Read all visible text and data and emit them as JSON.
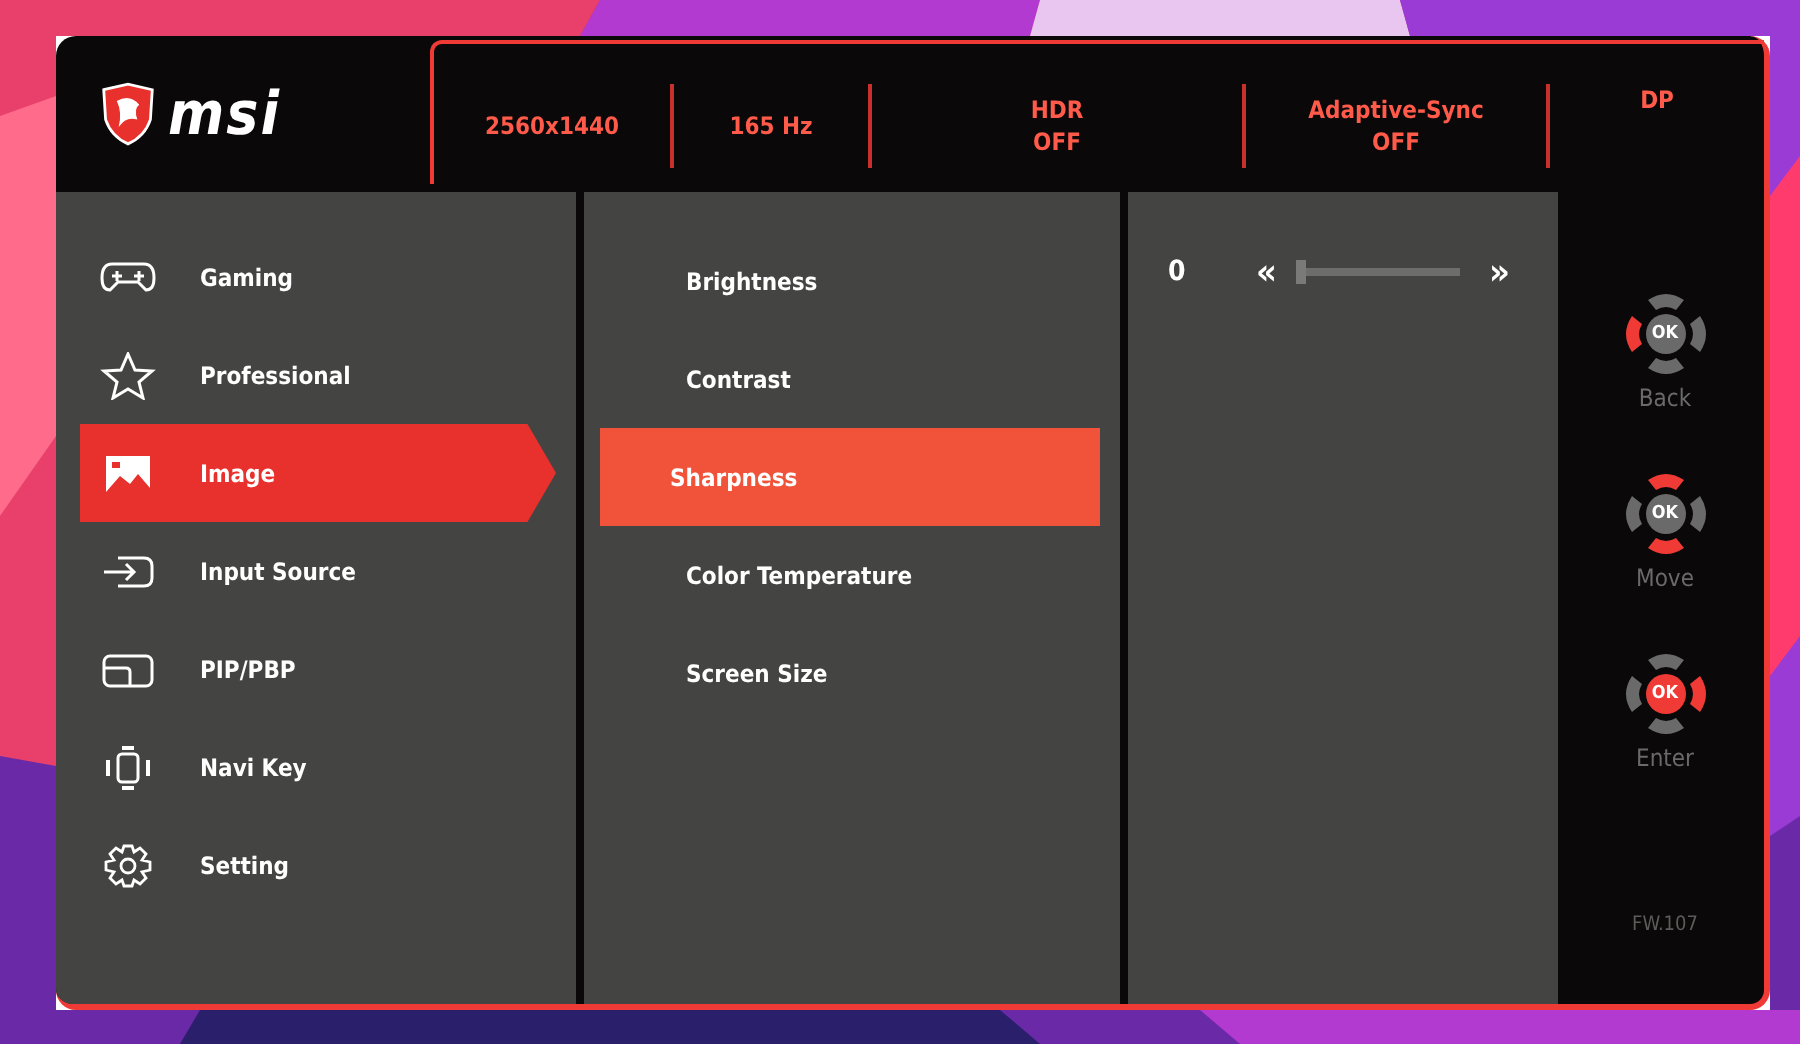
{
  "logo": {
    "text": "msi"
  },
  "status": [
    {
      "lines": [
        "2560x1440"
      ]
    },
    {
      "lines": [
        "165 Hz"
      ]
    },
    {
      "lines": [
        "HDR",
        "OFF"
      ]
    },
    {
      "lines": [
        "Adaptive-Sync",
        "OFF"
      ]
    },
    {
      "lines": [
        "DP"
      ]
    }
  ],
  "menu": [
    {
      "label": "Gaming",
      "kind": "gamepad",
      "selected": false
    },
    {
      "label": "Professional",
      "kind": "star",
      "selected": false
    },
    {
      "label": "Image",
      "selected": true
    },
    {
      "label": "Input Source",
      "kind": "input",
      "selected": false
    },
    {
      "label": "PIP/PBP",
      "kind": "window",
      "selected": false
    },
    {
      "label": "Navi Key",
      "kind": "navi",
      "selected": false
    },
    {
      "label": "Setting",
      "kind": "gear",
      "selected": false
    }
  ],
  "submenu": [
    {
      "label": "Brightness",
      "selected": false
    },
    {
      "label": "Contrast",
      "selected": false
    },
    {
      "label": "Sharpness",
      "selected": true
    },
    {
      "label": "Color Temperature",
      "selected": false
    },
    {
      "label": "Screen Size",
      "selected": false
    }
  ],
  "value": {
    "reading": "0",
    "decrease": "«",
    "increase": "»",
    "level": 0
  },
  "guides": [
    {
      "kind": "back",
      "ok": "OK",
      "label": "Back"
    },
    {
      "kind": "move",
      "ok": "OK",
      "label": "Move"
    },
    {
      "kind": "enter",
      "ok": "OK",
      "label": "Enter"
    }
  ],
  "firmware": "FW.107"
}
